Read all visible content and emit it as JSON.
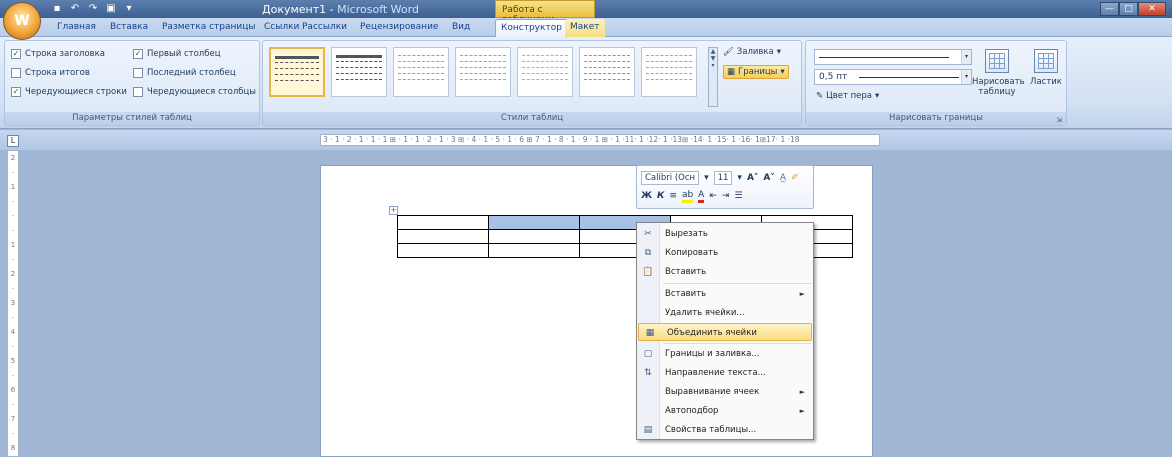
{
  "title_bar": {
    "office_glyph": "W",
    "doc_title_main": "Документ1",
    "doc_title_sep": " - ",
    "doc_title_app": "Microsoft Word",
    "context_title": "Работа с таблицами",
    "min": "—",
    "max": "□",
    "close": "✕"
  },
  "tabs": [
    "Главная",
    "Вставка",
    "Разметка страницы",
    "Ссылки",
    "Рассылки",
    "Рецензирование",
    "Вид",
    "Конструктор",
    "Макет"
  ],
  "ribbon": {
    "style_options": {
      "items": [
        {
          "label": "Строка заголовка",
          "checked": true
        },
        {
          "label": "Строка итогов",
          "checked": false
        },
        {
          "label": "Чередующиеся строки",
          "checked": true
        },
        {
          "label": "Первый столбец",
          "checked": true
        },
        {
          "label": "Последний столбец",
          "checked": false
        },
        {
          "label": "Чередующиеся столбцы",
          "checked": false
        }
      ],
      "group_label": "Параметры стилей таблиц"
    },
    "table_styles": {
      "group_label": "Стили таблиц",
      "shading": "Заливка",
      "borders": "Границы",
      "style_colors": [
        "#555555",
        "#555555",
        "#7ea6d8",
        "#d98a86",
        "#a7c26a",
        "#9c86c2",
        "#6fbcc8"
      ]
    },
    "draw_borders": {
      "weight": "0,5 пт",
      "pen_color": "Цвет пера",
      "draw_table": "Нарисовать таблицу",
      "eraser": "Ластик",
      "group_label": "Нарисовать границы"
    }
  },
  "ruler": {
    "tab_stop": "L",
    "h_marks": "3 · 1 · 2 · 1 · 1 · 1 ⊞ · 1 · 1 · 2 · 1 · 3 ⊞ · 4 · 1 · 5 · 1 · 6 ⊞ 7 · 1 · 8 · 1 · 9 · 1 ⊞ · 1 ·11· 1 ·12· 1 ·13⊞ ·14· 1 ·15· 1 ·16· 1⊞17· 1 ·18",
    "v_marks": [
      "2",
      "·",
      "1",
      "·",
      "·",
      "·",
      "1",
      "·",
      "2",
      "·",
      "3",
      "·",
      "4",
      "·",
      "5",
      "·",
      "6",
      "·",
      "7",
      "·",
      "8"
    ]
  },
  "mini_toolbar": {
    "font": "Calibri (Осн",
    "size": "11",
    "grow": "A˄",
    "shrink": "A˅",
    "bold": "Ж",
    "italic": "К"
  },
  "context_menu": [
    {
      "label": "Вырезать",
      "icon": "✂",
      "has_sub": false
    },
    {
      "label": "Копировать",
      "icon": "⧉",
      "has_sub": false
    },
    {
      "label": "Вставить",
      "icon": "📋",
      "has_sub": false
    },
    {
      "label": "Вставить",
      "icon": "",
      "has_sub": true
    },
    {
      "label": "Удалить ячейки...",
      "icon": "",
      "has_sub": false
    },
    {
      "label": "Объединить ячейки",
      "icon": "▦",
      "has_sub": false,
      "highlighted": true
    },
    {
      "label": "Границы и заливка...",
      "icon": "▢",
      "has_sub": false
    },
    {
      "label": "Направление текста...",
      "icon": "⇅",
      "has_sub": false
    },
    {
      "label": "Выравнивание ячеек",
      "icon": "",
      "has_sub": true
    },
    {
      "label": "Автоподбор",
      "icon": "",
      "has_sub": true
    },
    {
      "label": "Свойства таблицы...",
      "icon": "▤",
      "has_sub": false
    }
  ]
}
